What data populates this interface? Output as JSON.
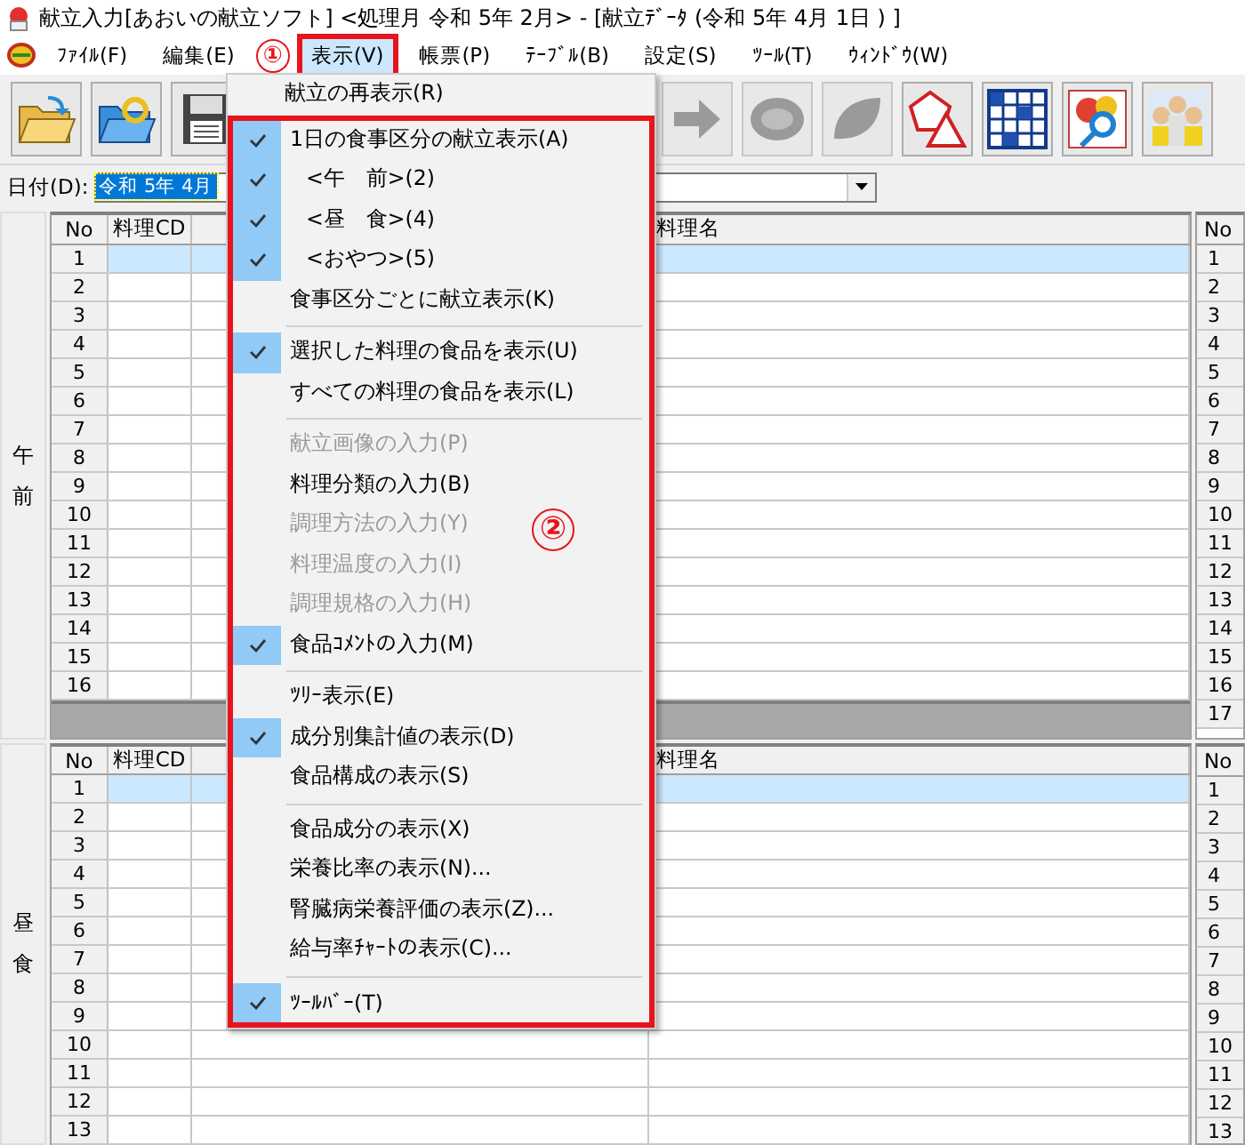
{
  "window": {
    "title": "献立入力[あおいの献立ソフト] <処理月 令和 5年 2月> - [献立ﾃﾞｰﾀ (令和 5年 4月 1日 ) ]"
  },
  "menubar": [
    {
      "label": "ﾌｧｲﾙ(F)",
      "selected": false,
      "highlighted": false
    },
    {
      "label": "編集(E)",
      "selected": false,
      "highlighted": false
    },
    {
      "label": "表示(V)",
      "selected": true,
      "highlighted": true
    },
    {
      "label": "帳票(P)",
      "selected": false,
      "highlighted": false
    },
    {
      "label": "ﾃｰﾌﾞﾙ(B)",
      "selected": false,
      "highlighted": false
    },
    {
      "label": "設定(S)",
      "selected": false,
      "highlighted": false
    },
    {
      "label": "ﾂｰﾙ(T)",
      "selected": false,
      "highlighted": false
    },
    {
      "label": "ｳｨﾝﾄﾞｳ(W)",
      "selected": false,
      "highlighted": false
    }
  ],
  "callouts": [
    {
      "label": "①"
    },
    {
      "label": "②"
    }
  ],
  "toolbar": [
    {
      "kind": "open",
      "disabled": false
    },
    {
      "kind": "reload",
      "disabled": false
    },
    {
      "kind": "save",
      "disabled": false
    },
    {
      "kind": "gap"
    },
    {
      "kind": "arrow",
      "disabled": true
    },
    {
      "kind": "blob",
      "disabled": true
    },
    {
      "kind": "leaf",
      "disabled": true
    },
    {
      "kind": "shapes",
      "disabled": false
    },
    {
      "kind": "grid",
      "disabled": false
    },
    {
      "kind": "food",
      "disabled": false
    },
    {
      "kind": "people",
      "disabled": false
    }
  ],
  "date": {
    "label": "日付(D):",
    "value": "令和 5年 4月"
  },
  "menu": {
    "sections": [
      {
        "highlighted": false,
        "items": [
          {
            "kind": "item",
            "label": "献立の再表示(R)",
            "checked": false,
            "disabled": false
          }
        ]
      },
      {
        "highlighted": true,
        "items": [
          {
            "kind": "item",
            "label": "1日の食事区分の献立表示(A)",
            "checked": true,
            "disabled": false,
            "children": [
              {
                "label": "<午　前>(2)",
                "checked": true
              },
              {
                "label": "<昼　食>(4)",
                "checked": true
              },
              {
                "label": "<おやつ>(5)",
                "checked": true
              }
            ]
          },
          {
            "kind": "item",
            "label": "食事区分ごとに献立表示(K)",
            "checked": false,
            "disabled": false
          },
          {
            "kind": "separator"
          },
          {
            "kind": "item",
            "label": "選択した料理の食品を表示(U)",
            "checked": true,
            "disabled": false
          },
          {
            "kind": "item",
            "label": "すべての料理の食品を表示(L)",
            "checked": false,
            "disabled": false
          },
          {
            "kind": "separator"
          },
          {
            "kind": "item",
            "label": "献立画像の入力(P)",
            "checked": false,
            "disabled": true
          },
          {
            "kind": "item",
            "label": "料理分類の入力(B)",
            "checked": false,
            "disabled": false
          },
          {
            "kind": "item",
            "label": "調理方法の入力(Y)",
            "checked": false,
            "disabled": true
          },
          {
            "kind": "item",
            "label": "料理温度の入力(I)",
            "checked": false,
            "disabled": true
          },
          {
            "kind": "item",
            "label": "調理規格の入力(H)",
            "checked": false,
            "disabled": true
          },
          {
            "kind": "item",
            "label": "食品ｺﾒﾝﾄの入力(M)",
            "checked": true,
            "disabled": false
          },
          {
            "kind": "separator"
          },
          {
            "kind": "item",
            "label": "ﾂﾘｰ表示(E)",
            "checked": false,
            "disabled": false
          },
          {
            "kind": "item",
            "label": "成分別集計値の表示(D)",
            "checked": true,
            "disabled": false
          },
          {
            "kind": "item",
            "label": "食品構成の表示(S)",
            "checked": false,
            "disabled": false
          },
          {
            "kind": "separator"
          },
          {
            "kind": "item",
            "label": "食品成分の表示(X)",
            "checked": false,
            "disabled": false
          },
          {
            "kind": "item",
            "label": "栄養比率の表示(N)...",
            "checked": false,
            "disabled": false
          },
          {
            "kind": "item",
            "label": "腎臓病栄養評価の表示(Z)...",
            "checked": false,
            "disabled": false
          },
          {
            "kind": "item",
            "label": "給与率ﾁｬｰﾄの表示(C)...",
            "checked": false,
            "disabled": false
          },
          {
            "kind": "separator"
          },
          {
            "kind": "item",
            "label": "ﾂｰﾙﾊﾞｰ(T)",
            "checked": true,
            "disabled": false
          }
        ]
      }
    ]
  },
  "panels": [
    {
      "label": "午前",
      "footer_band": true,
      "table": {
        "columns": [
          "No",
          "料理CD",
          "料理名"
        ],
        "rows": [
          {
            "no": "1",
            "selected": true
          },
          {
            "no": "2",
            "selected": false
          },
          {
            "no": "3",
            "selected": false
          },
          {
            "no": "4",
            "selected": false
          },
          {
            "no": "5",
            "selected": false
          },
          {
            "no": "6",
            "selected": false
          },
          {
            "no": "7",
            "selected": false
          },
          {
            "no": "8",
            "selected": false
          },
          {
            "no": "9",
            "selected": false
          },
          {
            "no": "10",
            "selected": false
          },
          {
            "no": "11",
            "selected": false
          },
          {
            "no": "12",
            "selected": false
          },
          {
            "no": "13",
            "selected": false
          },
          {
            "no": "14",
            "selected": false
          },
          {
            "no": "15",
            "selected": false
          },
          {
            "no": "16",
            "selected": false
          }
        ]
      },
      "side_table": {
        "column": "No",
        "rows": [
          "1",
          "2",
          "3",
          "4",
          "5",
          "6",
          "7",
          "8",
          "9",
          "10",
          "11",
          "12",
          "13",
          "14",
          "15",
          "16",
          "17"
        ]
      }
    },
    {
      "label": "昼食",
      "footer_band": false,
      "table": {
        "columns": [
          "No",
          "料理CD",
          "料理名"
        ],
        "rows": [
          {
            "no": "1",
            "selected": true
          },
          {
            "no": "2",
            "selected": false
          },
          {
            "no": "3",
            "selected": false
          },
          {
            "no": "4",
            "selected": false
          },
          {
            "no": "5",
            "selected": false
          },
          {
            "no": "6",
            "selected": false
          },
          {
            "no": "7",
            "selected": false
          },
          {
            "no": "8",
            "selected": false
          },
          {
            "no": "9",
            "selected": false
          },
          {
            "no": "10",
            "selected": false
          },
          {
            "no": "11",
            "selected": false
          },
          {
            "no": "12",
            "selected": false
          },
          {
            "no": "13",
            "selected": false
          }
        ]
      },
      "side_table": {
        "column": "No",
        "rows": [
          "1",
          "2",
          "3",
          "4",
          "5",
          "6",
          "7",
          "8",
          "9",
          "10",
          "11",
          "12",
          "13"
        ]
      }
    }
  ]
}
